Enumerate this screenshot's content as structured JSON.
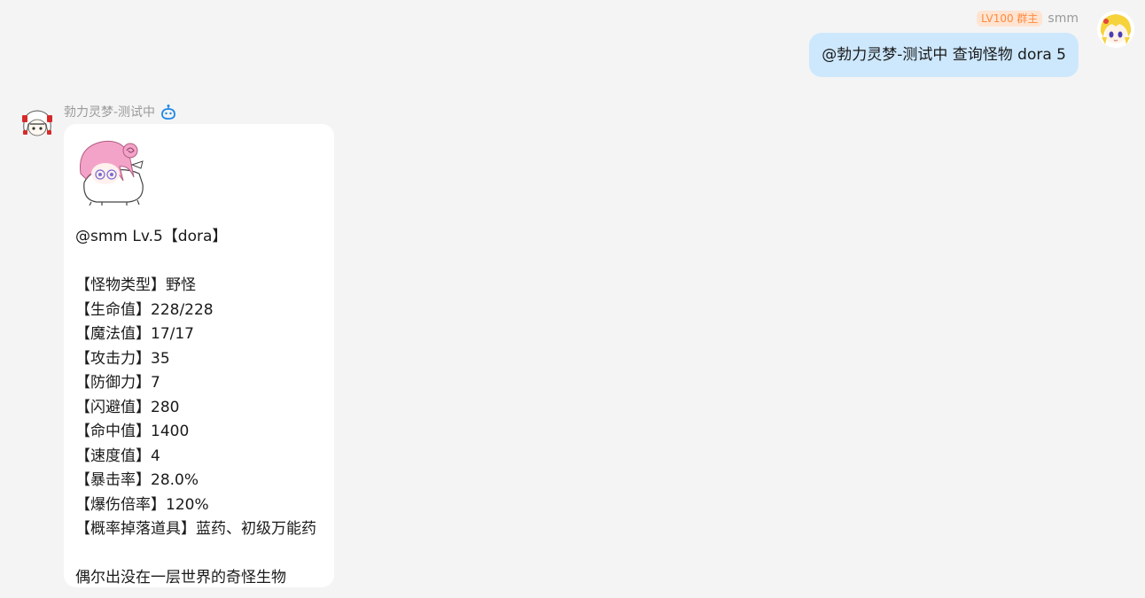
{
  "user_message": {
    "badge": "LV100 群主",
    "sender": "smm",
    "text": "@勃力灵梦-测试中 查询怪物 dora 5"
  },
  "bot_message": {
    "sender": "勃力灵梦-测试中",
    "lines": [
      "@smm Lv.5【dora】",
      "",
      "【怪物类型】野怪",
      "【生命值】228/228",
      "【魔法值】17/17",
      "【攻击力】35",
      "【防御力】7",
      "【闪避值】280",
      "【命中值】1400",
      "【速度值】4",
      "【暴击率】28.0%",
      "【爆伤倍率】120%",
      "【概率掉落道具】蓝药、初级万能药",
      "",
      "偶尔出没在一层世界的奇怪生物"
    ]
  },
  "colors": {
    "background": "#f4f4f4",
    "user_bubble": "#cde8fd",
    "bot_bubble": "#ffffff",
    "badge_text": "#ff8a3d",
    "badge_bg": "#ffe4d2",
    "robot_icon": "#1e88e5"
  },
  "icons": {
    "bot_marker": "robot-icon",
    "user_avatar": "blonde-anime-avatar",
    "bot_avatar": "white-hair-anime-avatar",
    "monster_sticker": "pink-hair-creature-sticker"
  }
}
